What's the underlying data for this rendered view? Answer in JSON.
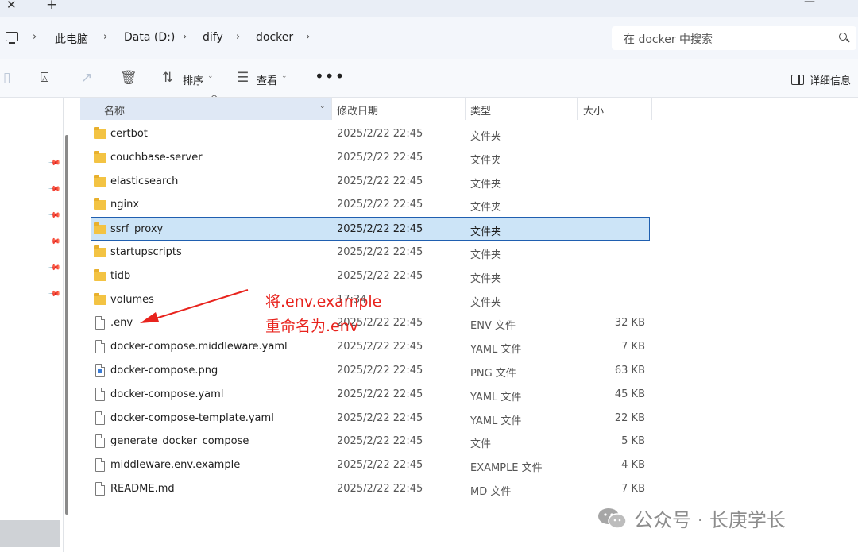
{
  "tabbar": {
    "close_glyph": "✕",
    "new_tab_glyph": "+",
    "minimize_glyph": "—"
  },
  "breadcrumb": [
    "此电脑",
    "Data (D:)",
    "dify",
    "docker"
  ],
  "search": {
    "placeholder": "在 docker 中搜索"
  },
  "toolbar": {
    "sort_label": "排序",
    "view_label": "查看",
    "more": "•••",
    "details_label": "详细信息"
  },
  "columns": {
    "name": "名称",
    "date": "修改日期",
    "type": "类型",
    "size": "大小"
  },
  "files": [
    {
      "name": "certbot",
      "date": "2025/2/22 22:45",
      "type": "文件夹",
      "size": "",
      "icon": "folder-icon"
    },
    {
      "name": "couchbase-server",
      "date": "2025/2/22 22:45",
      "type": "文件夹",
      "size": "",
      "icon": "folder-icon"
    },
    {
      "name": "elasticsearch",
      "date": "2025/2/22 22:45",
      "type": "文件夹",
      "size": "",
      "icon": "folder-icon"
    },
    {
      "name": "nginx",
      "date": "2025/2/22 22:45",
      "type": "文件夹",
      "size": "",
      "icon": "folder-icon"
    },
    {
      "name": "ssrf_proxy",
      "date": "2025/2/22 22:45",
      "type": "文件夹",
      "size": "",
      "icon": "folder-icon",
      "selected": true
    },
    {
      "name": "startupscripts",
      "date": "2025/2/22 22:45",
      "type": "文件夹",
      "size": "",
      "icon": "folder-icon"
    },
    {
      "name": "tidb",
      "date": "2025/2/22 22:45",
      "type": "文件夹",
      "size": "",
      "icon": "folder-icon"
    },
    {
      "name": "volumes",
      "date": "17:34",
      "type": "文件夹",
      "size": "",
      "icon": "folder-icon"
    },
    {
      "name": ".env",
      "date": "2025/2/22 22:45",
      "type": "ENV 文件",
      "size": "32 KB",
      "icon": "file-icon"
    },
    {
      "name": "docker-compose.middleware.yaml",
      "date": "2025/2/22 22:45",
      "type": "YAML 文件",
      "size": "7 KB",
      "icon": "file-icon"
    },
    {
      "name": "docker-compose.png",
      "date": "2025/2/22 22:45",
      "type": "PNG 文件",
      "size": "63 KB",
      "icon": "image-file-icon"
    },
    {
      "name": "docker-compose.yaml",
      "date": "2025/2/22 22:45",
      "type": "YAML 文件",
      "size": "45 KB",
      "icon": "file-icon"
    },
    {
      "name": "docker-compose-template.yaml",
      "date": "2025/2/22 22:45",
      "type": "YAML 文件",
      "size": "22 KB",
      "icon": "file-icon"
    },
    {
      "name": "generate_docker_compose",
      "date": "2025/2/22 22:45",
      "type": "文件",
      "size": "5 KB",
      "icon": "file-icon"
    },
    {
      "name": "middleware.env.example",
      "date": "2025/2/22 22:45",
      "type": "EXAMPLE 文件",
      "size": "4 KB",
      "icon": "file-icon"
    },
    {
      "name": "README.md",
      "date": "2025/2/22 22:45",
      "type": "MD 文件",
      "size": "7 KB",
      "icon": "file-icon"
    }
  ],
  "annotation": {
    "line1": "将.env.example",
    "line2": "重命名为.env",
    "color": "#e8231d"
  },
  "watermark": {
    "text": "公众号 · 长庚学长"
  },
  "colors": {
    "selection_bg": "#cce4f7",
    "selection_border": "#1f5fb0",
    "folder": "#f3c343"
  }
}
